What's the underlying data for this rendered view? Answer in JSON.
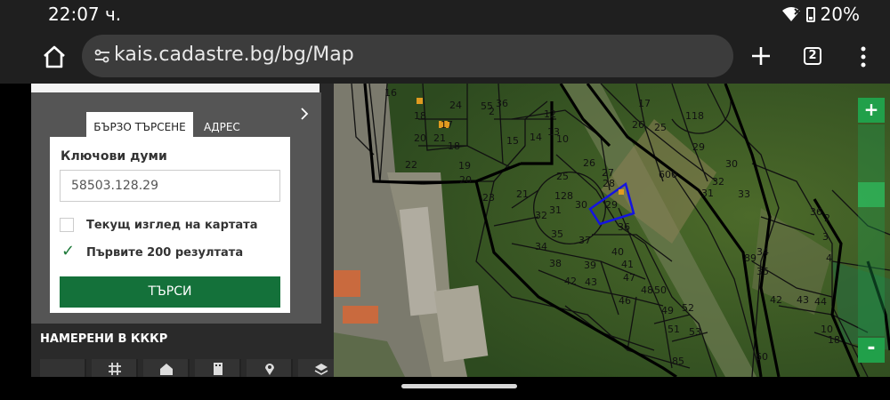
{
  "status_bar": {
    "time": "22:07 ч.",
    "battery": "20%",
    "battery_percent": 20
  },
  "browser": {
    "url": "kais.cadastre.bg/bg/Map",
    "tab_count": "2"
  },
  "search": {
    "tab_quick": "БЪРЗО ТЪРСЕНЕ",
    "tab_address": "АДРЕС",
    "keywords_label": "Ключови думи",
    "keywords_value": "58503.128.29",
    "current_view_label": "Текущ изглед на картата",
    "current_view_checked": false,
    "first200_label": "Първите 200 резултата",
    "first200_checked": true,
    "search_button": "ТЪРСИ"
  },
  "results": {
    "title": "НАМЕРЕНИ В КККР",
    "icons": [
      "list-icon",
      "grid-icon",
      "home-icon",
      "building-icon",
      "location-pin-icon",
      "layers-icon"
    ]
  },
  "map": {
    "zoom_in": "+",
    "zoom_out": "-",
    "selected_parcel": "29",
    "parcel_labels": [
      {
        "t": "16"
      },
      {
        "t": "18"
      },
      {
        "t": "20"
      },
      {
        "t": "21"
      },
      {
        "t": "22"
      },
      {
        "t": "55"
      },
      {
        "t": "36"
      },
      {
        "t": "24"
      },
      {
        "t": "17"
      },
      {
        "t": "18"
      },
      {
        "t": "19"
      },
      {
        "t": "2"
      },
      {
        "t": "12"
      },
      {
        "t": "15"
      },
      {
        "t": "14"
      },
      {
        "t": "13"
      },
      {
        "t": "10"
      },
      {
        "t": "20"
      },
      {
        "t": "23"
      },
      {
        "t": "21"
      },
      {
        "t": "25"
      },
      {
        "t": "26"
      },
      {
        "t": "27"
      },
      {
        "t": "28"
      },
      {
        "t": "128"
      },
      {
        "t": "31"
      },
      {
        "t": "30"
      },
      {
        "t": "29"
      },
      {
        "t": "32"
      },
      {
        "t": "34"
      },
      {
        "t": "35"
      },
      {
        "t": "37"
      },
      {
        "t": "36"
      },
      {
        "t": "38"
      },
      {
        "t": "39"
      },
      {
        "t": "40"
      },
      {
        "t": "41"
      },
      {
        "t": "42"
      },
      {
        "t": "43"
      },
      {
        "t": "47"
      },
      {
        "t": "46"
      },
      {
        "t": "48"
      },
      {
        "t": "50"
      },
      {
        "t": "49"
      },
      {
        "t": "51"
      },
      {
        "t": "53"
      },
      {
        "t": "52"
      },
      {
        "t": "85"
      },
      {
        "t": "60"
      },
      {
        "t": "600"
      },
      {
        "t": "17"
      },
      {
        "t": "26"
      },
      {
        "t": "25"
      },
      {
        "t": "118"
      },
      {
        "t": "29"
      },
      {
        "t": "30"
      },
      {
        "t": "32"
      },
      {
        "t": "31"
      },
      {
        "t": "33"
      },
      {
        "t": "34"
      },
      {
        "t": "35"
      },
      {
        "t": "36"
      },
      {
        "t": "2"
      },
      {
        "t": "3"
      },
      {
        "t": "4"
      },
      {
        "t": "89"
      },
      {
        "t": "42"
      },
      {
        "t": "43"
      },
      {
        "t": "44"
      },
      {
        "t": "10"
      },
      {
        "t": "18"
      }
    ]
  }
}
